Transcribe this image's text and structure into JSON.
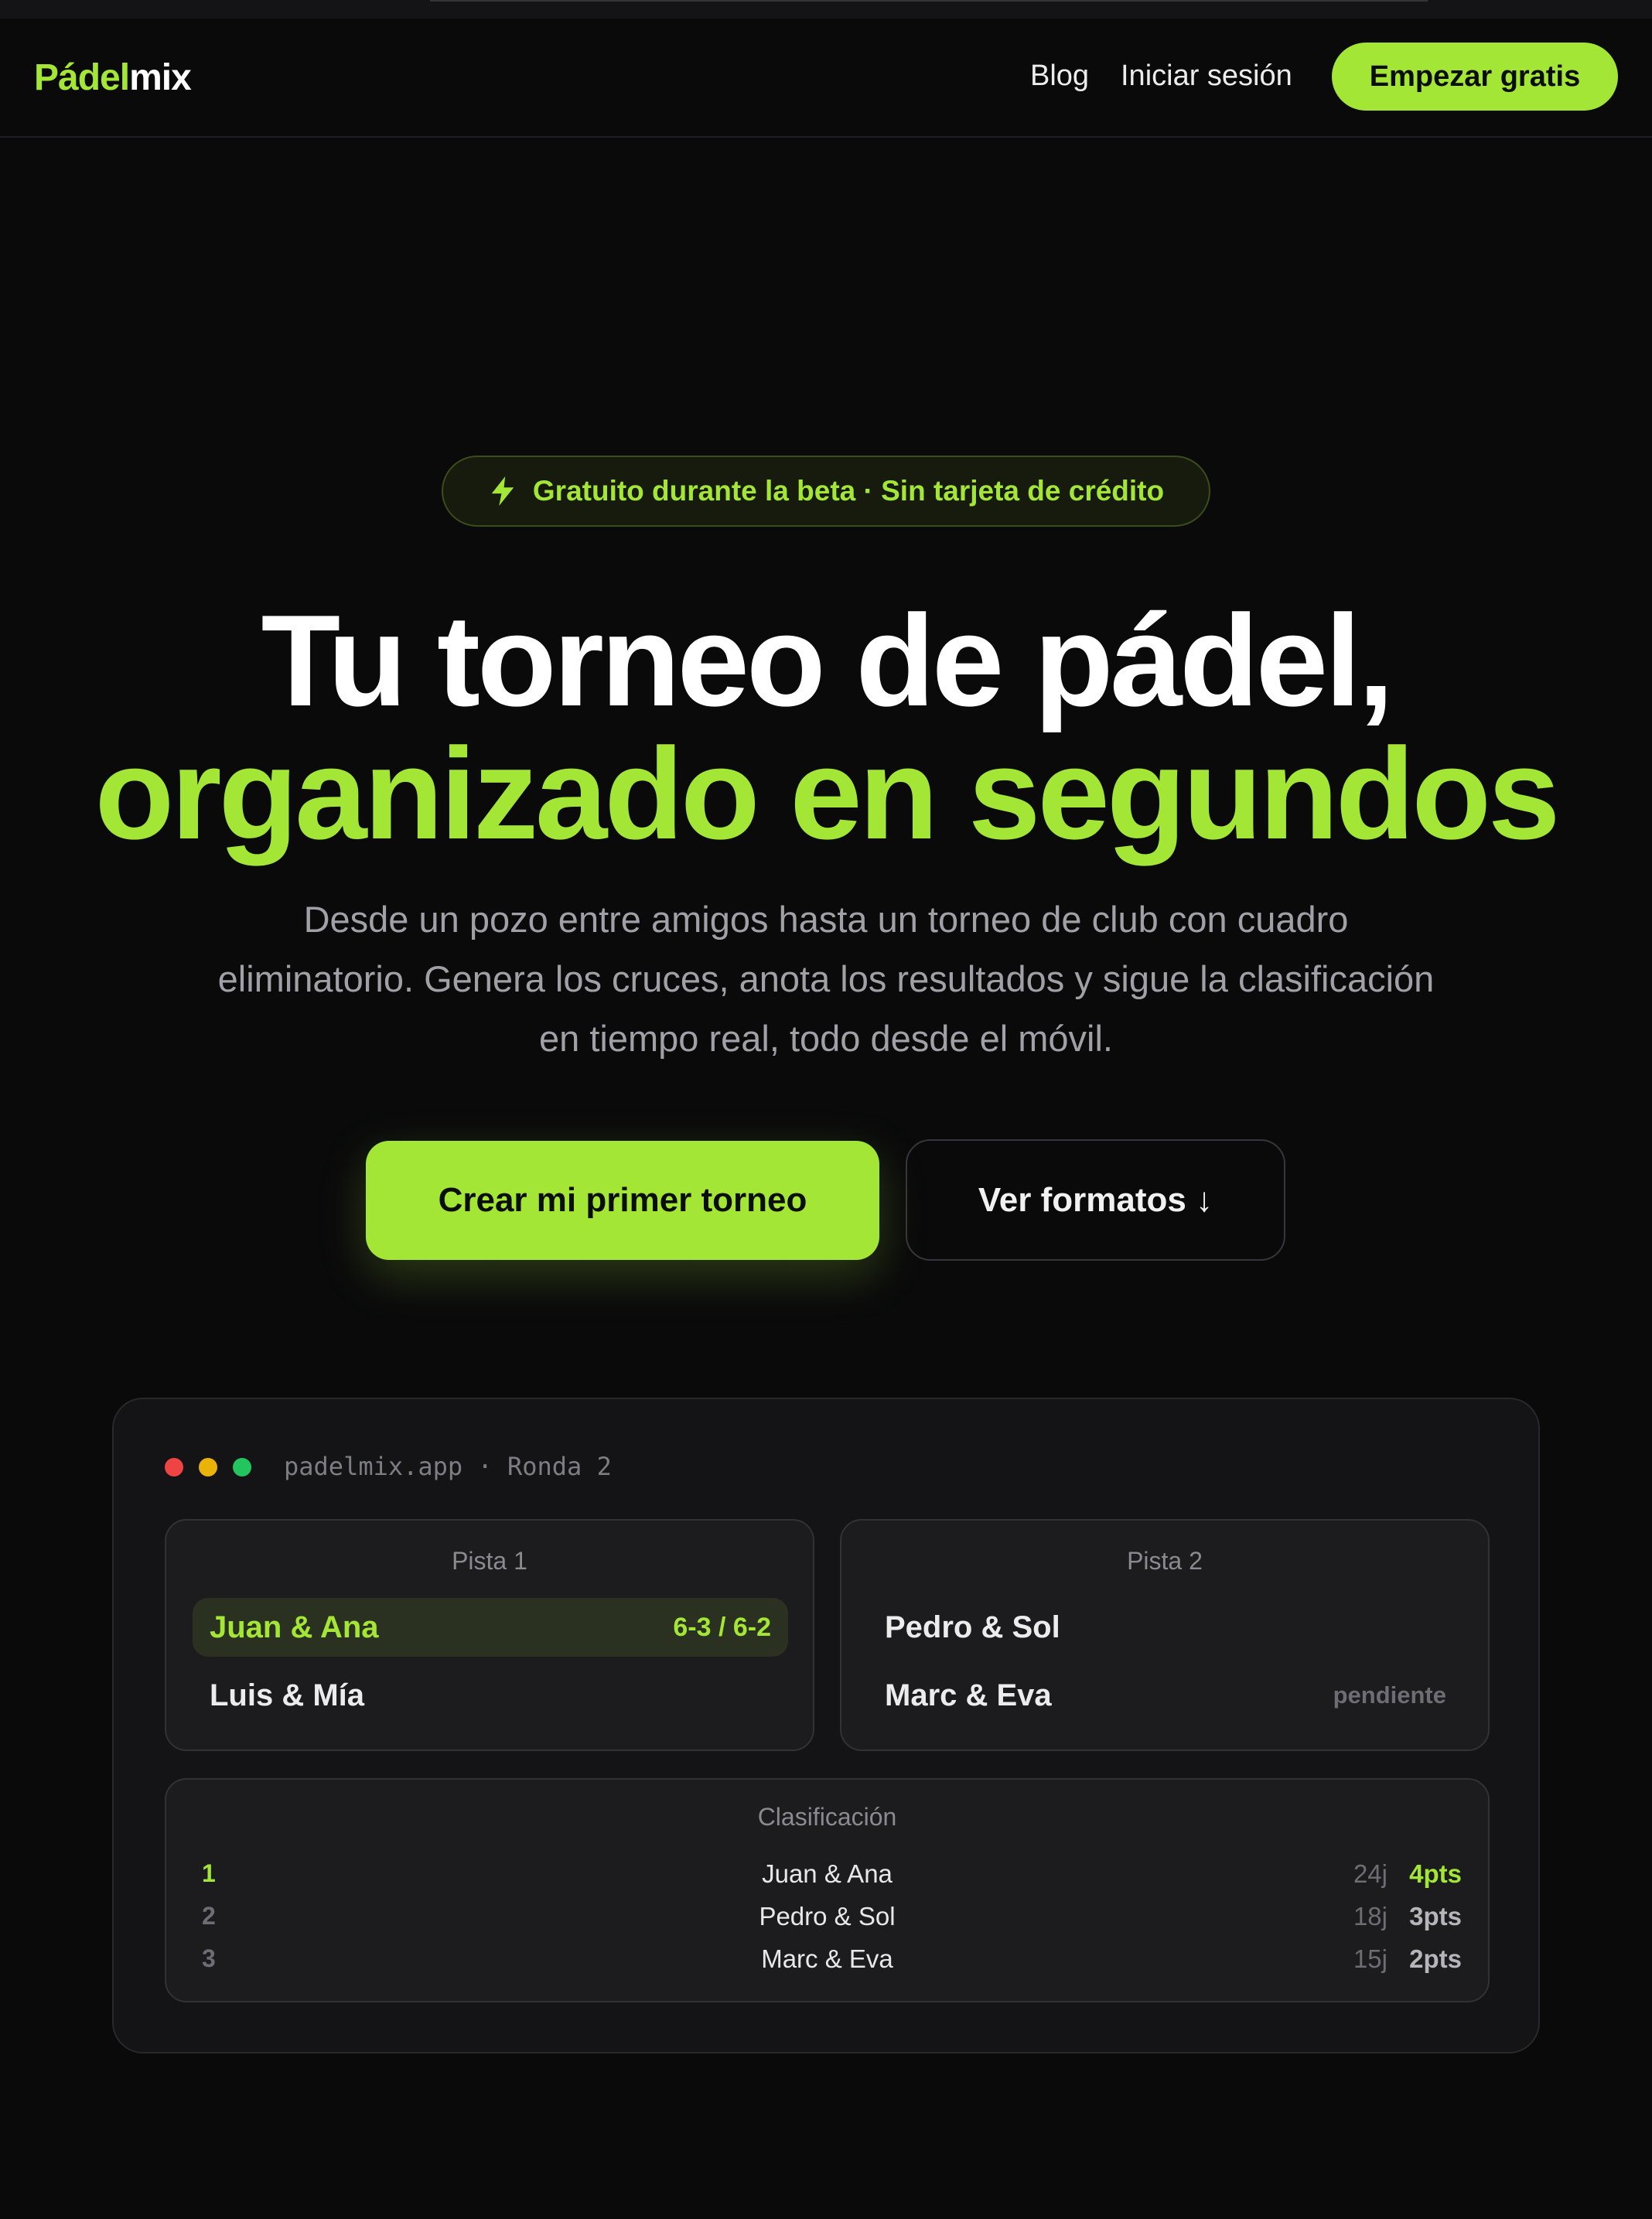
{
  "nav": {
    "logo_part1": "Pádel",
    "logo_part2": "mix",
    "blog": "Blog",
    "login": "Iniciar sesión",
    "cta": "Empezar gratis"
  },
  "hero": {
    "badge": "Gratuito durante la beta · Sin tarjeta de crédito",
    "title_line1": "Tu torneo de pádel,",
    "title_line2": "organizado en segundos",
    "subtitle": "Desde un pozo entre amigos hasta un torneo de club con cuadro eliminatorio. Genera los cruces, anota los resultados y sigue la clasificación en tiempo real, todo desde el móvil.",
    "primary_button": "Crear mi primer torneo",
    "secondary_button": "Ver formatos ↓"
  },
  "preview": {
    "url": "padelmix.app · Ronda 2",
    "courts": [
      {
        "title": "Pista 1",
        "team1": "Juan & Ana",
        "team1_score": "6-3 / 6-2",
        "team2": "Luis & Mía"
      },
      {
        "title": "Pista 2",
        "team1": "Pedro & Sol",
        "team2": "Marc & Eva",
        "status": "pendiente"
      }
    ],
    "standings": {
      "title": "Clasificación",
      "rows": [
        {
          "pos": "1",
          "name": "Juan & Ana",
          "games": "24j",
          "points": "4pts"
        },
        {
          "pos": "2",
          "name": "Pedro & Sol",
          "games": "18j",
          "points": "3pts"
        },
        {
          "pos": "3",
          "name": "Marc & Eva",
          "games": "15j",
          "points": "2pts"
        }
      ]
    }
  },
  "colors": {
    "accent": "#a3e635",
    "background": "#0a0a0b",
    "card": "#1c1c1f"
  },
  "icons": {
    "badge_icon": "lightning-bolt-icon",
    "window_controls": [
      "red-dot",
      "yellow-dot",
      "green-dot"
    ]
  }
}
